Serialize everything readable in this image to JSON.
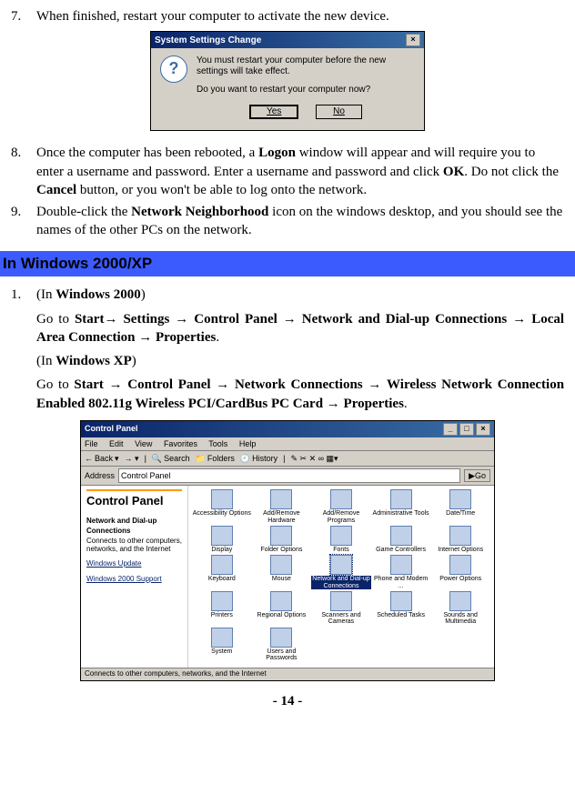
{
  "steps": {
    "s7": {
      "num": "7.",
      "text": "When finished, restart your computer to activate the new device."
    },
    "s8": {
      "num": "8.",
      "pre": "Once the computer has been rebooted, a ",
      "logon": "Logon",
      "mid1": " window will appear and will require you to enter a username and password. Enter a username and password and click ",
      "ok": "OK",
      "mid2": ".    Do not click the ",
      "cancel": "Cancel",
      "post": " button, or you won't be able to log onto the network."
    },
    "s9": {
      "num": "9.",
      "pre": "Double-click the ",
      "nn": "Network Neighborhood",
      "post": " icon on the windows desktop, and you should see the names of the other PCs on the network."
    }
  },
  "dialog": {
    "title": "System Settings Change",
    "close": "×",
    "icon": "?",
    "msg1": "You must restart your computer before the new settings will take effect.",
    "msg2": "Do you want to restart your computer now?",
    "yes": "Yes",
    "no": "No"
  },
  "section": {
    "title": "In Windows 2000/XP"
  },
  "win2000": {
    "num": "1.",
    "label_pre": "(In ",
    "label_b": "Windows 2000",
    "label_post": ")",
    "path_pre": "Go to ",
    "p1": "Start",
    "arrow": "→",
    "p2": "Settings",
    "p3": "Control Panel",
    "p4": "Network and Dial-up Connections",
    "p5": "Local Area Connection",
    "p6": "Properties",
    "dot": "."
  },
  "winxp": {
    "label_pre": "(In ",
    "label_b": "Windows XP",
    "label_post": ")",
    "path_pre": "Go to ",
    "p1": "Start",
    "p2": "Control Panel",
    "p3": "Network Connections",
    "p4": "Wireless Network Connection Enabled 802.11g Wireless PCI/CardBus PC Card",
    "p5": "Properties",
    "dot": "."
  },
  "cp": {
    "title": "Control Panel",
    "min": "_",
    "max": "□",
    "close": "×",
    "menu": {
      "file": "File",
      "edit": "Edit",
      "view": "View",
      "fav": "Favorites",
      "tools": "Tools",
      "help": "Help"
    },
    "tb": {
      "back": "Back",
      "search": "Search",
      "folders": "Folders",
      "history": "History"
    },
    "addr_label": "Address",
    "addr_value": "Control Panel",
    "go": "Go",
    "side_title": "Control Panel",
    "side_sub": "Network and Dial-up Connections",
    "side_desc": "Connects to other computers, networks, and the Internet",
    "link1": "Windows Update",
    "link2": "Windows 2000 Support",
    "items": [
      "Accessibility Options",
      "Add/Remove Hardware",
      "Add/Remove Programs",
      "Administrative Tools",
      "Date/Time",
      "Display",
      "Folder Options",
      "Fonts",
      "Game Controllers",
      "Internet Options",
      "Keyboard",
      "Mouse",
      "Network and Dial-up Connections",
      "Phone and Modem ...",
      "Power Options",
      "Printers",
      "Regional Options",
      "Scanners and Cameras",
      "Scheduled Tasks",
      "Sounds and Multimedia",
      "System",
      "Users and Passwords"
    ],
    "selected_index": 12,
    "status": "Connects to other computers, networks, and the Internet"
  },
  "footer": "- 14 -"
}
